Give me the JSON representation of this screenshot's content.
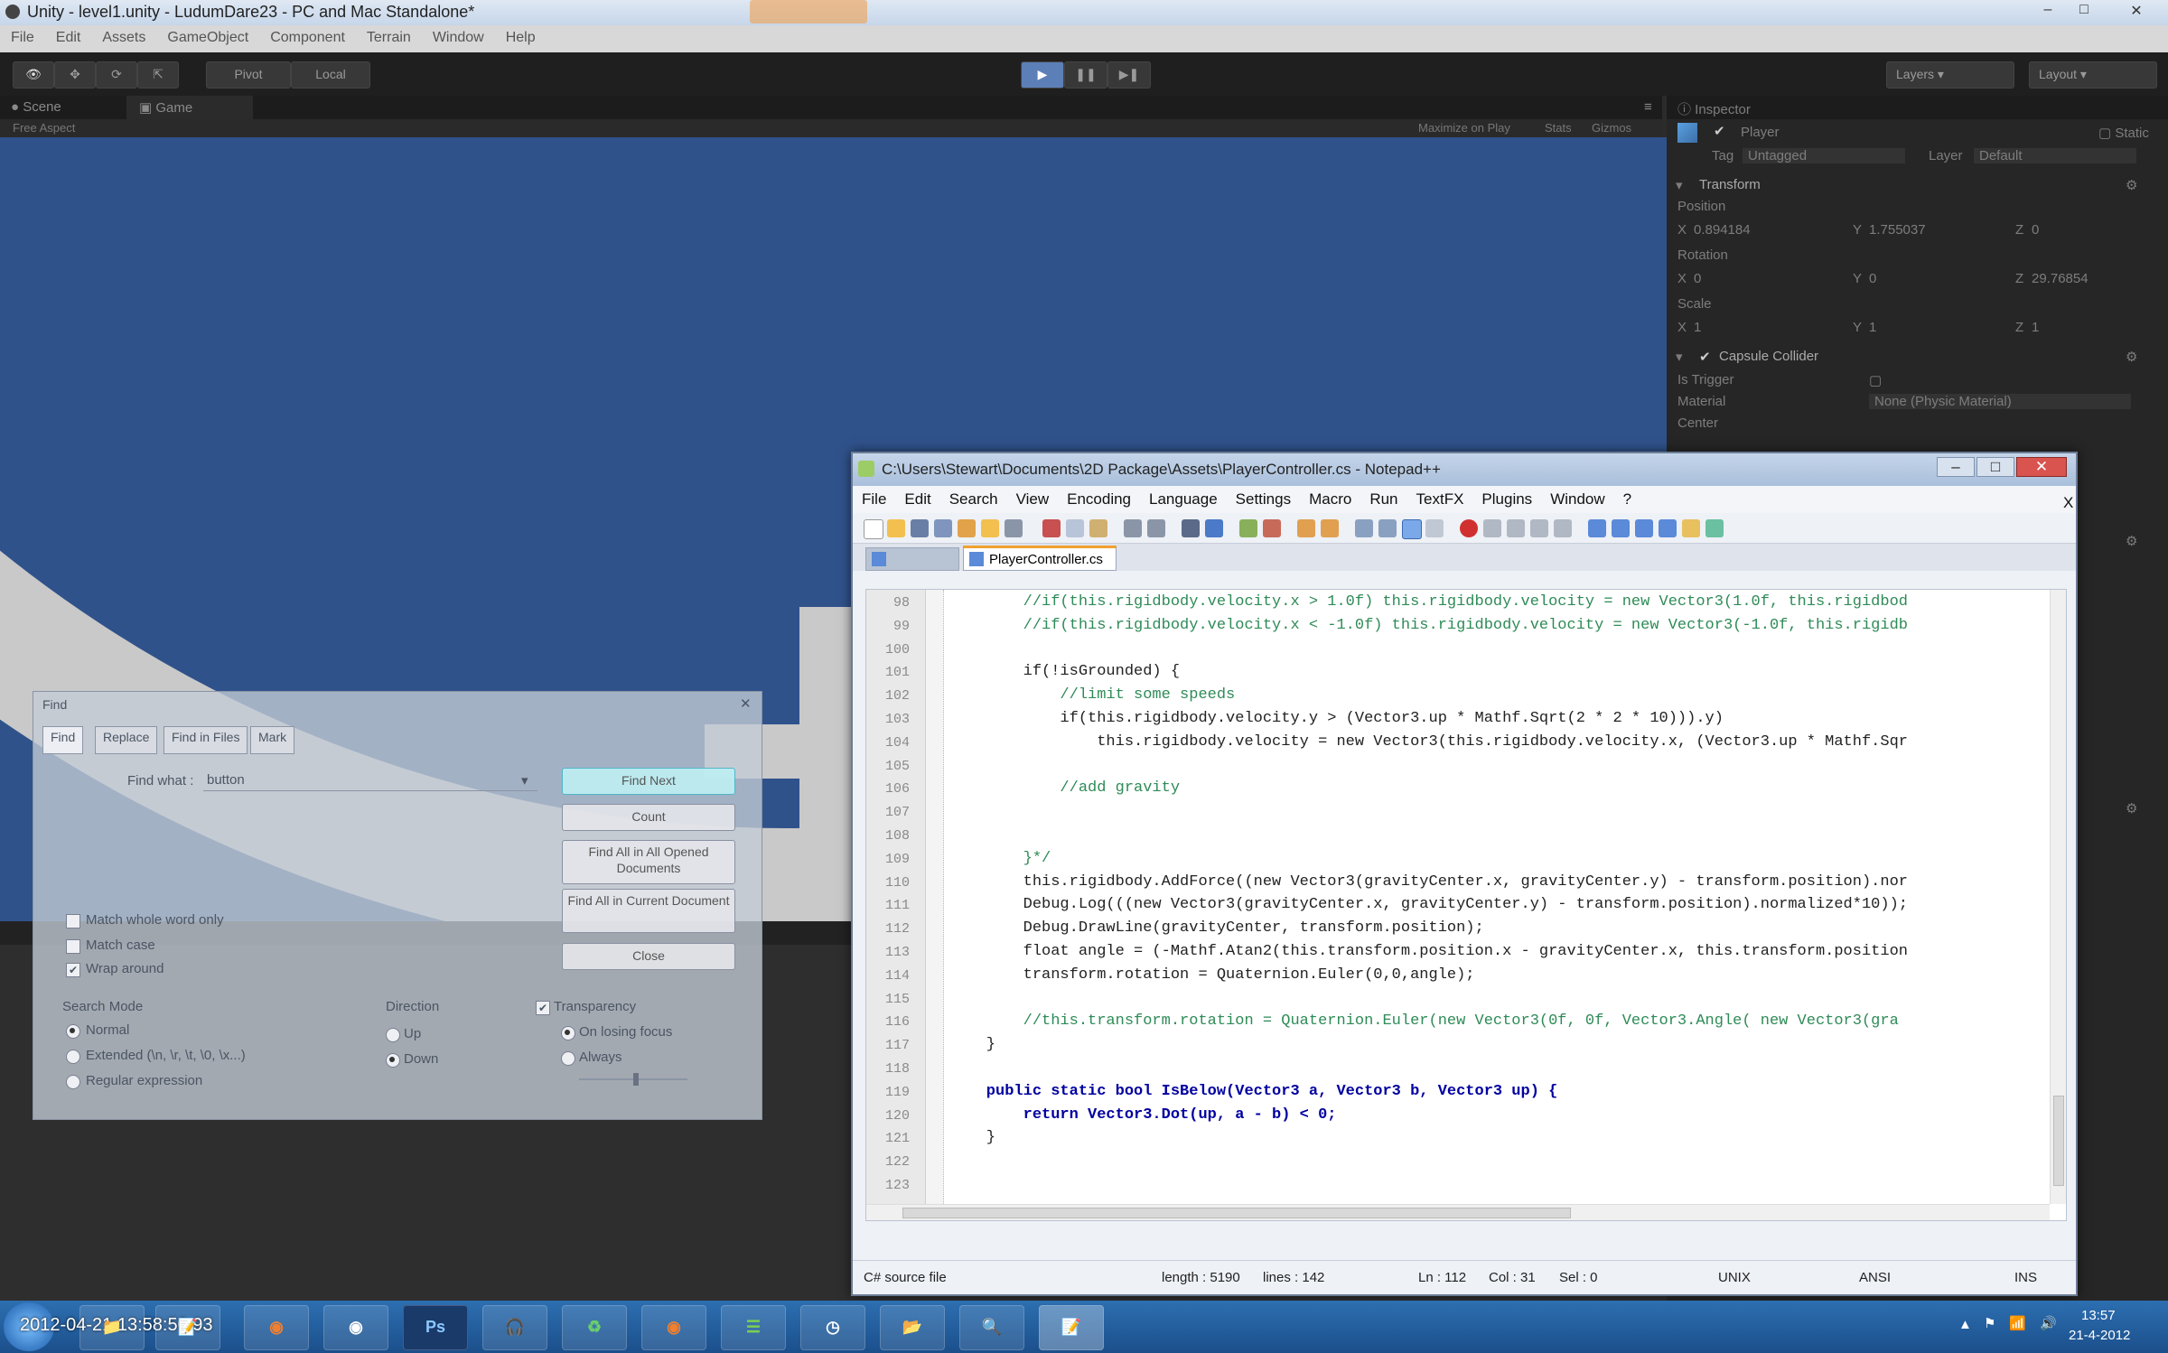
{
  "unity": {
    "title": "Unity - level1.unity - LudumDare23 - PC and Mac Standalone*",
    "menu": [
      "File",
      "Edit",
      "Assets",
      "GameObject",
      "Component",
      "Terrain",
      "Window",
      "Help"
    ],
    "toolbar": {
      "pivot": "Pivot",
      "local": "Local",
      "layers": "Layers",
      "layout": "Layout"
    },
    "scene_tabs": [
      "Scene",
      "Game"
    ],
    "scene_sub": {
      "aspect": "Free Aspect",
      "maximize": "Maximize on Play",
      "stats": "Stats",
      "gizmos": "Gizmos"
    }
  },
  "inspector": {
    "tab": "Inspector",
    "object_name": "Player",
    "static_label": "Static",
    "tag_label": "Tag",
    "tag_value": "Untagged",
    "layer_label": "Layer",
    "layer_value": "Default",
    "transform": "Transform",
    "position": "Position",
    "pos_x": "X",
    "pos_x_val": "0.894184",
    "pos_y": "Y",
    "pos_y_val": "1.755037",
    "pos_z": "Z",
    "pos_z_val": "0",
    "rotation": "Rotation",
    "rot_x": "X",
    "rot_x_val": "0",
    "rot_y": "Y",
    "rot_y_val": "0",
    "rot_z": "Z",
    "rot_z_val": "29.76854",
    "scale": "Scale",
    "scl_x": "X",
    "scl_x_val": "1",
    "scl_y": "Y",
    "scl_y_val": "1",
    "scl_z": "Z",
    "scl_z_val": "1",
    "collider": "Capsule Collider",
    "is_trigger": "Is Trigger",
    "material": "Material",
    "material_value": "None (Physic Material)",
    "center": "Center"
  },
  "find_dialog": {
    "title": "Find",
    "tabs": [
      "Find",
      "Replace",
      "Find in Files",
      "Mark"
    ],
    "find_what_label": "Find what :",
    "find_what_value": "button",
    "buttons": {
      "find_next": "Find Next",
      "count": "Count",
      "find_all_opened": "Find All in All Opened Documents",
      "find_all_current": "Find All in Current Document",
      "close": "Close"
    },
    "options": [
      "Match whole word only",
      "Match case",
      "Wrap around"
    ],
    "search_mode_label": "Search Mode",
    "search_modes": [
      "Normal",
      "Extended (\\n, \\r, \\t, \\0, \\x...)",
      "Regular expression"
    ],
    "direction_label": "Direction",
    "directions": [
      "Up",
      "Down"
    ],
    "transparency_label": "Transparency",
    "transparency_opts": [
      "On losing focus",
      "Always"
    ]
  },
  "notepad": {
    "title": "C:\\Users\\Stewart\\Documents\\2D Package\\Assets\\PlayerController.cs - Notepad++",
    "menu": [
      "File",
      "Edit",
      "Search",
      "View",
      "Encoding",
      "Language",
      "Settings",
      "Macro",
      "Run",
      "TextFX",
      "Plugins",
      "Window",
      "?"
    ],
    "close_x": "X",
    "tab_active": "PlayerController.cs",
    "lines": [
      {
        "n": "98",
        "code": "        //if(this.rigidbody.velocity.x > 1.0f) this.rigidbody.velocity = new Vector3(1.0f, this.rigidbod"
      },
      {
        "n": "99",
        "code": "        //if(this.rigidbody.velocity.x < -1.0f) this.rigidbody.velocity = new Vector3(-1.0f, this.rigidb"
      },
      {
        "n": "100",
        "code": ""
      },
      {
        "n": "101",
        "code": "        if(!isGrounded) {"
      },
      {
        "n": "102",
        "code": "            //limit some speeds"
      },
      {
        "n": "103",
        "code": "            if(this.rigidbody.velocity.y > (Vector3.up * Mathf.Sqrt(2 * 2 * 10))).y)"
      },
      {
        "n": "104",
        "code": "                this.rigidbody.velocity = new Vector3(this.rigidbody.velocity.x, (Vector3.up * Mathf.Sqr"
      },
      {
        "n": "105",
        "code": ""
      },
      {
        "n": "106",
        "code": "            //add gravity"
      },
      {
        "n": "107",
        "code": ""
      },
      {
        "n": "108",
        "code": ""
      },
      {
        "n": "109",
        "code": "        }*/"
      },
      {
        "n": "110",
        "code": "        this.rigidbody.AddForce((new Vector3(gravityCenter.x, gravityCenter.y) - transform.position).nor"
      },
      {
        "n": "111",
        "code": "        Debug.Log(((new Vector3(gravityCenter.x, gravityCenter.y) - transform.position).normalized*10));"
      },
      {
        "n": "112",
        "code": "        Debug.DrawLine(gravityCenter, transform.position);"
      },
      {
        "n": "113",
        "code": "        float angle = (-Mathf.Atan2(this.transform.position.x - gravityCenter.x, this.transform.position"
      },
      {
        "n": "114",
        "code": "        transform.rotation = Quaternion.Euler(0,0,angle);"
      },
      {
        "n": "115",
        "code": ""
      },
      {
        "n": "116",
        "code": "        //this.transform.rotation = Quaternion.Euler(new Vector3(0f, 0f, Vector3.Angle( new Vector3(gra"
      },
      {
        "n": "117",
        "code": "    }"
      },
      {
        "n": "118",
        "code": ""
      },
      {
        "n": "119",
        "code": "    public static bool IsBelow(Vector3 a, Vector3 b, Vector3 up) {"
      },
      {
        "n": "120",
        "code": "        return Vector3.Dot(up, a - b) < 0;"
      },
      {
        "n": "121",
        "code": "    }"
      },
      {
        "n": "122",
        "code": ""
      },
      {
        "n": "123",
        "code": ""
      }
    ],
    "status": {
      "type": "C# source file",
      "length": "length : 5190",
      "lines": "lines : 142",
      "ln": "Ln : 112",
      "col": "Col : 31",
      "sel": "Sel : 0",
      "eol": "UNIX",
      "enc": "ANSI",
      "ins": "INS"
    }
  },
  "taskbar": {
    "timestamp_overlay": "2012-04-21 13:58:50.93",
    "apps": [
      "start-orb",
      "explorer",
      "notepad",
      "blender",
      "unity",
      "photoshop",
      "headphones",
      "recycle",
      "firefox",
      "spotify",
      "clock",
      "folder",
      "network",
      "notepadpp"
    ],
    "ps_label": "Ps",
    "clock_time": "13:57",
    "clock_date": "21-4-2012"
  },
  "colors": {
    "scene_bg": "#30528b",
    "ring": "#c9c9c9",
    "unity_dark": "#262626",
    "taskbar": "#2d6fb1"
  }
}
